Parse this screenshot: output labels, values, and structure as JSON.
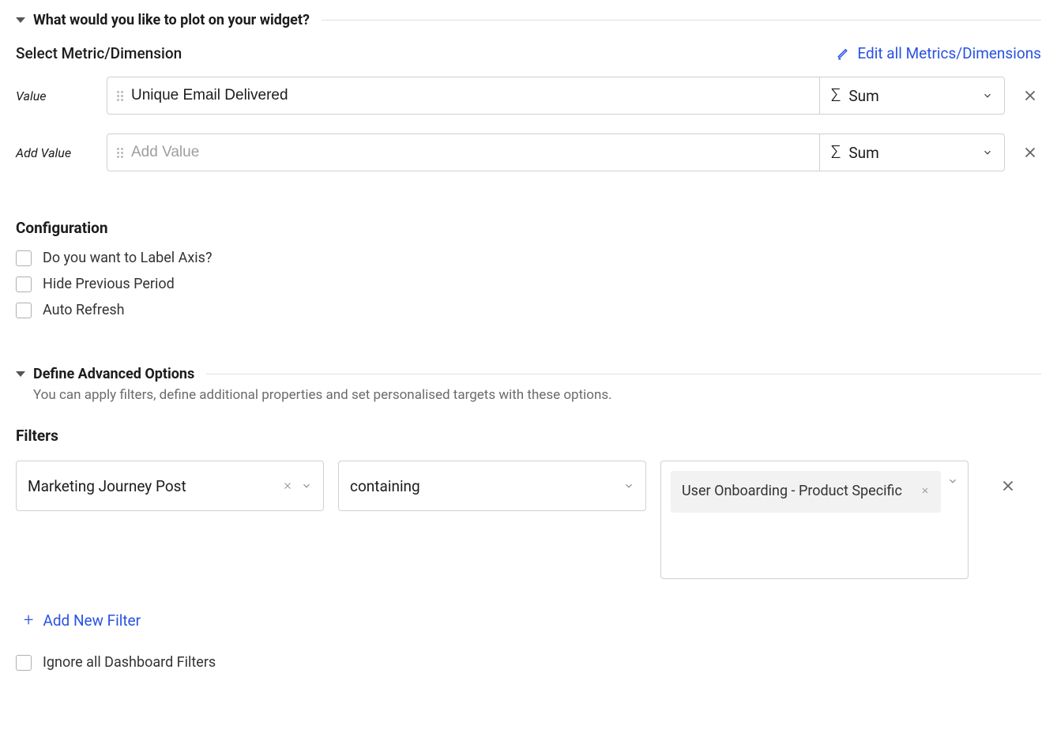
{
  "section1": {
    "title": "What would you like to plot on your widget?",
    "subsection_title": "Select Metric/Dimension",
    "edit_link": "Edit all Metrics/Dimensions",
    "value_label": "Value",
    "value_input": "Unique Email Delivered",
    "value_agg": "Sum",
    "addvalue_label": "Add Value",
    "addvalue_placeholder": "Add Value",
    "addvalue_agg": "Sum"
  },
  "configuration": {
    "title": "Configuration",
    "option1": "Do you want to Label Axis?",
    "option2": "Hide Previous Period",
    "option3": "Auto Refresh"
  },
  "advanced": {
    "title": "Define Advanced Options",
    "subtitle": "You can apply filters, define additional properties and set personalised targets with these options."
  },
  "filters": {
    "title": "Filters",
    "field": "Marketing Journey Post",
    "operator": "containing",
    "value_tag": "User Onboarding - Product Specific",
    "add_new": "Add New Filter",
    "ignore_all": "Ignore all Dashboard Filters"
  }
}
